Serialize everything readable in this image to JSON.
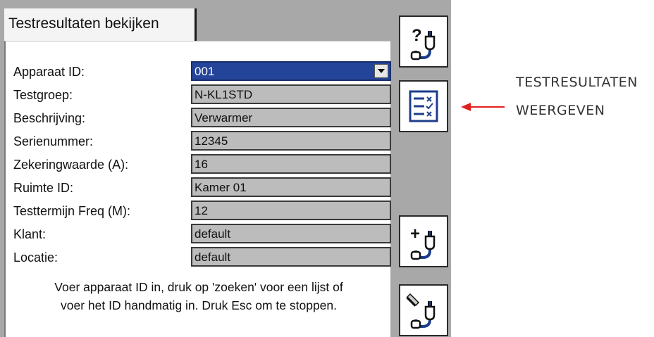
{
  "tab": {
    "title": "Testresultaten bekijken"
  },
  "form": {
    "fields": [
      {
        "label": "Apparaat ID:",
        "value": "001"
      },
      {
        "label": "Testgroep:",
        "value": "N-KL1STD"
      },
      {
        "label": "Beschrijving:",
        "value": "Verwarmer"
      },
      {
        "label": "Serienummer:",
        "value": "12345"
      },
      {
        "label": "Zekeringwaarde (A):",
        "value": "16"
      },
      {
        "label": "Ruimte ID:",
        "value": "Kamer 01"
      },
      {
        "label": "Testtermijn Freq (M):",
        "value": "12"
      },
      {
        "label": "Klant:",
        "value": "default"
      },
      {
        "label": "Locatie:",
        "value": "default"
      }
    ],
    "hint_line1": "Voer apparaat ID in, druk op 'zoeken'  voor een lijst of",
    "hint_line2": "voer het ID handmatig in. Druk Esc om te stoppen."
  },
  "toolbar": {
    "buttons": [
      {
        "icon": "question-plug-icon"
      },
      {
        "icon": "test-results-list-icon"
      },
      {
        "icon": "add-plug-icon"
      },
      {
        "icon": "edit-plug-icon"
      }
    ]
  },
  "annotation": {
    "line1": "TESTRESULTATEN",
    "line2": "WEERGEVEN",
    "arrow_color": "#e02020"
  },
  "colors": {
    "selected_field": "#24449a",
    "field_bg": "#bcbcbc",
    "screen_bg": "#a8a8a8",
    "icon_blue": "#1d3d8c"
  }
}
